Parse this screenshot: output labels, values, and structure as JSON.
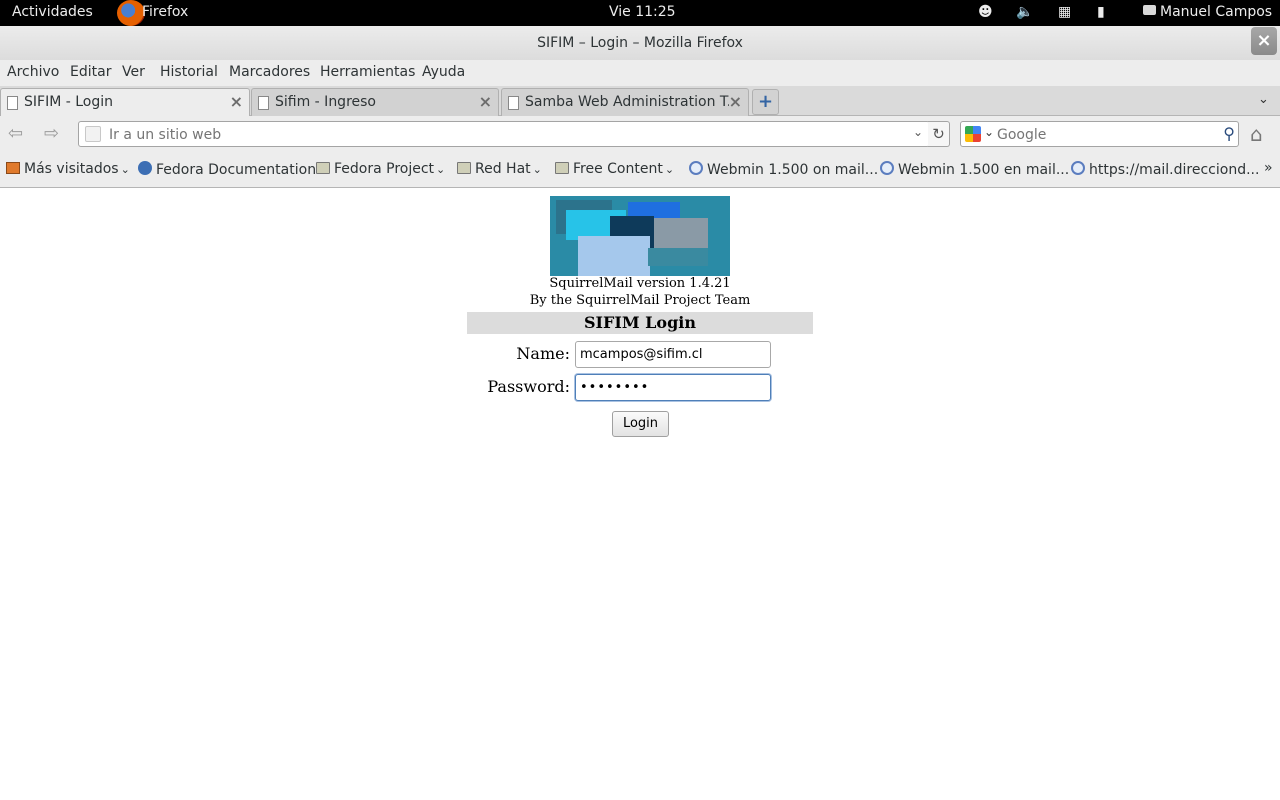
{
  "topbar": {
    "activities": "Actividades",
    "app_name": "Firefox",
    "clock": "Vie 11:25",
    "user": "Manuel Campos",
    "tray_icons": [
      "accessibility-icon",
      "volume-icon",
      "network-icon",
      "battery-icon"
    ]
  },
  "window": {
    "title": "SIFIM – Login – Mozilla Firefox",
    "close_glyph": "×"
  },
  "menubar": [
    "Archivo",
    "Editar",
    "Ver",
    "Historial",
    "Marcadores",
    "Herramientas",
    "Ayuda"
  ],
  "tabs": [
    {
      "label": "SIFIM - Login",
      "active": true
    },
    {
      "label": "Sifim - Ingreso",
      "active": false
    },
    {
      "label": "Samba Web Administration T...",
      "active": false
    }
  ],
  "navbar": {
    "url_placeholder": "Ir a un sitio web",
    "url_value": "",
    "search_placeholder": "Google"
  },
  "bookmarks": [
    {
      "label": "Más visitados",
      "icon": "most-visited-icon",
      "dropdown": true
    },
    {
      "label": "Fedora Documentation",
      "icon": "fedora-icon",
      "dropdown": false
    },
    {
      "label": "Fedora Project",
      "icon": "folder-icon",
      "dropdown": true
    },
    {
      "label": "Red Hat",
      "icon": "folder-icon",
      "dropdown": true
    },
    {
      "label": "Free Content",
      "icon": "folder-icon",
      "dropdown": true
    },
    {
      "label": "Webmin 1.500 on mail...",
      "icon": "webmin-icon",
      "dropdown": false
    },
    {
      "label": "Webmin 1.500 en mail...",
      "icon": "webmin-icon",
      "dropdown": false
    },
    {
      "label": "https://mail.direcciond...",
      "icon": "webmin-icon",
      "dropdown": false
    }
  ],
  "page": {
    "version_line": "SquirrelMail version 1.4.21",
    "team_line": "By the SquirrelMail Project Team",
    "login_header": "SIFIM Login",
    "name_label": "Name:",
    "name_value": "mcampos@sifim.cl",
    "password_label": "Password:",
    "password_value": "••••••••",
    "login_button": "Login"
  },
  "colors": {
    "topbar_bg": "#000000",
    "chrome_bg": "#ededed",
    "login_header_bg": "#dcdcdc",
    "logo_bg": "#2a8ba6",
    "focus_border": "#4f7fb8"
  }
}
